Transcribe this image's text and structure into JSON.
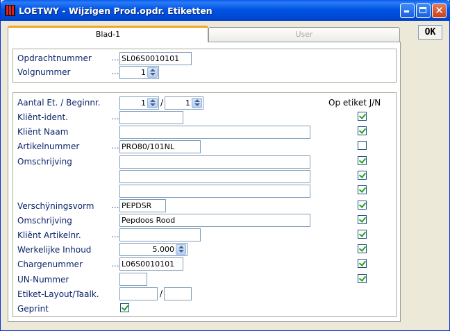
{
  "window": {
    "title": "LOETWY - Wijzigen Prod.opdr. Etiketten"
  },
  "toolbar": {
    "ok_label": "OK"
  },
  "tabs": [
    {
      "label": "Blad-1"
    },
    {
      "label": "User"
    }
  ],
  "header_group": {
    "opdrachtnummer": {
      "label": "Opdrachtnummer",
      "dots": "...",
      "value": "SL06S0010101"
    },
    "volgnummer": {
      "label": "Volgnummer",
      "dots": "...",
      "value": "1"
    }
  },
  "form": {
    "op_etiket_header": "Op etiket J/N",
    "aantal": {
      "label": "Aantal Et. / Beginnr.",
      "value1": "1",
      "slash": "/",
      "value2": "1"
    },
    "klient_ident": {
      "label": "Kliënt-ident.",
      "dots": "...",
      "value": ""
    },
    "klient_naam": {
      "label": "Kliënt Naam",
      "value": ""
    },
    "artikelnummer": {
      "label": "Artikelnummer",
      "dots": "...",
      "value": "PRO80/101NL"
    },
    "omschrijving": {
      "label": "Omschrijving",
      "lines": [
        "",
        "",
        ""
      ]
    },
    "verschijningsvorm": {
      "label": "Verschÿningsvorm",
      "dots": "...",
      "value": "PEPDSR"
    },
    "omschrijving2": {
      "label": "Omschrijving",
      "value": "Pepdoos Rood"
    },
    "klient_artikelnr": {
      "label": "Kliënt Artikelnr.",
      "dots": "...",
      "value": ""
    },
    "werkelijke_inhoud": {
      "label": "Werkelijke Inhoud",
      "value": "5.000"
    },
    "chargenummer": {
      "label": "Chargenummer",
      "dots": "...",
      "value": "L06S0010101"
    },
    "un_nummer": {
      "label": "UN-Nummer",
      "value": ""
    },
    "etiket_layout": {
      "label": "Etiket-Layout/Taalk.",
      "value1": "",
      "slash": "/",
      "value2": ""
    },
    "geprint": {
      "label": "Geprint",
      "checked": true
    }
  },
  "op_etiket_checks": [
    true,
    true,
    false,
    true,
    true,
    true,
    true,
    true,
    true,
    true,
    true,
    true
  ],
  "colors": {
    "label_blue": "#0A246A",
    "check_green": "#21A121",
    "titlebar": "#0054E3",
    "tab_accent": "#F5A623"
  }
}
